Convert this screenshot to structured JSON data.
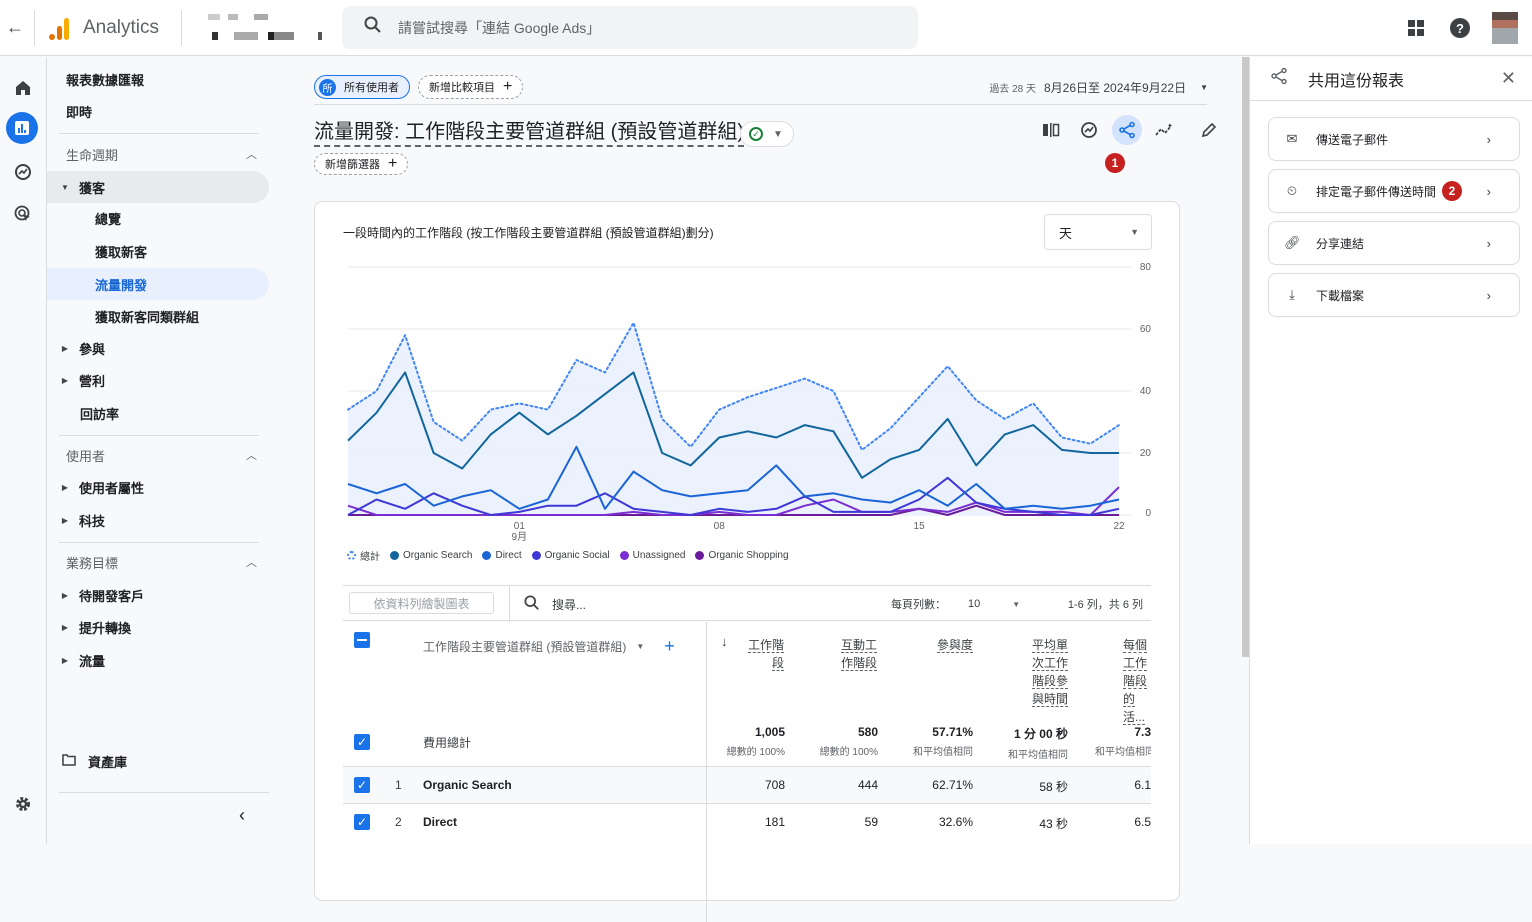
{
  "topbar": {
    "app_name": "Analytics",
    "search_placeholder": "請嘗試搜尋「連結 Google Ads」",
    "icons": [
      "back-arrow-icon",
      "analytics-logo",
      "search-icon",
      "apps-grid-icon",
      "help-icon",
      "avatar"
    ]
  },
  "rail": {
    "items": [
      "home",
      "reports",
      "explore",
      "advertising",
      "admin-settings"
    ]
  },
  "nav": {
    "reports_snapshot": "報表數據匯報",
    "realtime": "即時",
    "sections": [
      {
        "label": "生命週期",
        "items": [
          {
            "label": "獲客",
            "expanded": true,
            "children": [
              "總覽",
              "獲取新客",
              "流量開發",
              "獲取新客同類群組"
            ]
          },
          {
            "label": "參與"
          },
          {
            "label": "營利"
          },
          {
            "label": "回訪率"
          }
        ]
      },
      {
        "label": "使用者",
        "items": [
          {
            "label": "使用者屬性"
          },
          {
            "label": "科技"
          }
        ]
      },
      {
        "label": "業務目標",
        "items": [
          {
            "label": "待開發客戶"
          },
          {
            "label": "提升轉換"
          },
          {
            "label": "流量"
          }
        ]
      }
    ],
    "selected": "流量開發",
    "library": "資產庫"
  },
  "header": {
    "segment_chip_icon_letter": "所",
    "segment_chip": "所有使用者",
    "add_comparison": "新增比較項目",
    "date_prefix": "過去 28 天",
    "date_range": "8月26日至 2024年9月22日",
    "title": "流量開發: 工作階段主要管道群組 (預設管道群組)",
    "add_filter": "新增篩選器",
    "badge1": "1",
    "tools": [
      "compare-icon",
      "insights-icon",
      "share-icon",
      "anomaly-icon",
      "edit-icon"
    ]
  },
  "chart_card": {
    "title": "一段時間內的工作階段 (按工作階段主要管道群組 (預設管道群組)劃分)",
    "granularity": "天"
  },
  "chart_data": {
    "type": "line",
    "title": "一段時間內的工作階段 (按工作階段主要管道群組 (預設管道群組)劃分)",
    "x": [
      "08-26",
      "08-27",
      "08-28",
      "08-29",
      "08-30",
      "08-31",
      "09-01",
      "09-02",
      "09-03",
      "09-04",
      "09-05",
      "09-06",
      "09-07",
      "09-08",
      "09-09",
      "09-10",
      "09-11",
      "09-12",
      "09-13",
      "09-14",
      "09-15",
      "09-16",
      "09-17",
      "09-18",
      "09-19",
      "09-20",
      "09-21",
      "09-22"
    ],
    "x_tick_labels": [
      {
        "at": "09-01",
        "label": "01",
        "sub": "9月"
      },
      {
        "at": "09-08",
        "label": "08"
      },
      {
        "at": "09-15",
        "label": "15"
      },
      {
        "at": "09-22",
        "label": "22"
      }
    ],
    "ylim": [
      0,
      80
    ],
    "y_ticks": [
      0,
      20,
      40,
      60,
      80
    ],
    "y_axis_side": "right",
    "grid": true,
    "legend_position": "bottom-left",
    "series": [
      {
        "name": "總計",
        "color": "#4285f4",
        "style": "dotted-area",
        "values": [
          34,
          40,
          58,
          30,
          24,
          34,
          36,
          34,
          50,
          46,
          62,
          31,
          22,
          34,
          38,
          41,
          44,
          40,
          21,
          28,
          38,
          48,
          37,
          31,
          36,
          25,
          23,
          29
        ]
      },
      {
        "name": "Organic Search",
        "color": "#12669b",
        "values": [
          24,
          33,
          46,
          20,
          15,
          26,
          33,
          26,
          32,
          39,
          46,
          20,
          16,
          25,
          27,
          25,
          29,
          27,
          12,
          18,
          21,
          31,
          16,
          26,
          29,
          21,
          20,
          20
        ]
      },
      {
        "name": "Direct",
        "color": "#1a64d6",
        "values": [
          10,
          7,
          10,
          3,
          6,
          8,
          2,
          5,
          22,
          2,
          14,
          8,
          6,
          7,
          8,
          16,
          6,
          7,
          5,
          4,
          8,
          3,
          10,
          2,
          3,
          2,
          3,
          5
        ]
      },
      {
        "name": "Organic Social",
        "color": "#3f37d6",
        "values": [
          0,
          5,
          2,
          7,
          3,
          0,
          1,
          3,
          3,
          7,
          2,
          1,
          0,
          2,
          1,
          2,
          6,
          1,
          1,
          1,
          5,
          12,
          4,
          2,
          1,
          0,
          0,
          2
        ]
      },
      {
        "name": "Unassigned",
        "color": "#7b2fd1",
        "values": [
          3,
          0,
          0,
          0,
          0,
          0,
          0,
          0,
          0,
          0,
          1,
          0,
          0,
          1,
          0,
          0,
          3,
          5,
          1,
          1,
          2,
          1,
          4,
          1,
          1,
          1,
          0,
          9
        ]
      },
      {
        "name": "Organic Shopping",
        "color": "#6a1b9a",
        "values": [
          0,
          0,
          0,
          0,
          0,
          0,
          0,
          0,
          0,
          0,
          0,
          0,
          0,
          0,
          0,
          0,
          0,
          0,
          0,
          0,
          2,
          0,
          3,
          0,
          0,
          0,
          0,
          0
        ]
      }
    ]
  },
  "table": {
    "plot_rows_button": "依資料列繪製圖表",
    "search_placeholder": "搜尋...",
    "rows_per_page_label": "每頁列數：",
    "rows_per_page": "10",
    "page_info": "1-6 列，共 6 列",
    "dimension_header": "工作階段主要管道群組 (預設管道群組)",
    "metric_headers": [
      "工作階段",
      "互動工作階段",
      "參與度",
      "平均單次工作階段參與時間",
      "每個工作階段的活..."
    ],
    "sort_indicator": "↓",
    "totals_label": "費用總計",
    "totals": [
      {
        "value": "1,005",
        "sub": "總數的 100%"
      },
      {
        "value": "580",
        "sub": "總數的 100%"
      },
      {
        "value": "57.71%",
        "sub": "和平均值相同"
      },
      {
        "value": "1 分 00 秒",
        "sub": "和平均值相同"
      },
      {
        "value": "7.3",
        "sub": "和平均值相同"
      }
    ],
    "rows": [
      {
        "n": "1",
        "dim": "Organic Search",
        "values": [
          "708",
          "444",
          "62.71%",
          "58 秒",
          "6.1"
        ]
      },
      {
        "n": "2",
        "dim": "Direct",
        "values": [
          "181",
          "59",
          "32.6%",
          "43 秒",
          "6.5"
        ]
      }
    ]
  },
  "share_panel": {
    "title": "共用這份報表",
    "options": [
      {
        "label": "傳送電子郵件",
        "icon": "mail-icon"
      },
      {
        "label": "排定電子郵件傳送時間",
        "icon": "schedule-send-icon",
        "badge": "2"
      },
      {
        "label": "分享連結",
        "icon": "link-icon"
      },
      {
        "label": "下載檔案",
        "icon": "download-icon"
      }
    ]
  }
}
